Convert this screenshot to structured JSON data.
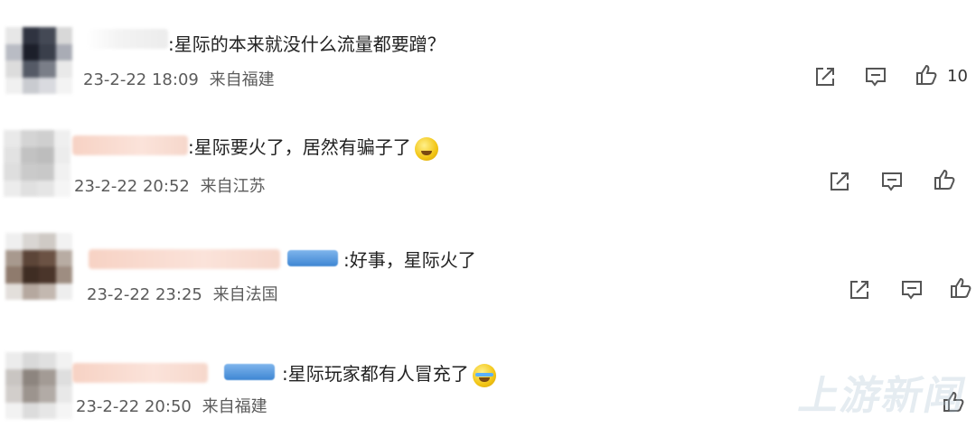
{
  "comments": [
    {
      "text": "星际的本来就没什么流量都要蹭？",
      "time": "23-2-22 18:09",
      "location": "来自福建",
      "likes": "10",
      "has_badge": false,
      "emoji": ""
    },
    {
      "text": "星际要火了，居然有骗子了",
      "time": "23-2-22 20:52",
      "location": "来自江苏",
      "likes": "",
      "has_badge": false,
      "emoji": "grimace-emoji"
    },
    {
      "text": "好事，星际火了",
      "time": "23-2-22 23:25",
      "location": "来自法国",
      "likes": "",
      "has_badge": true,
      "emoji": ""
    },
    {
      "text": "星际玩家都有人冒充了",
      "time": "23-2-22 20:50",
      "location": "来自福建",
      "likes": "",
      "has_badge": true,
      "emoji": "crying-laugh-emoji"
    }
  ],
  "colors": {
    "text": "#222222",
    "meta": "#5b5b5b",
    "icon": "#555555",
    "badge": "#3e86d3",
    "name_blur": "#f7d2c4"
  },
  "icons": [
    "share-icon",
    "comment-icon",
    "like-icon"
  ]
}
